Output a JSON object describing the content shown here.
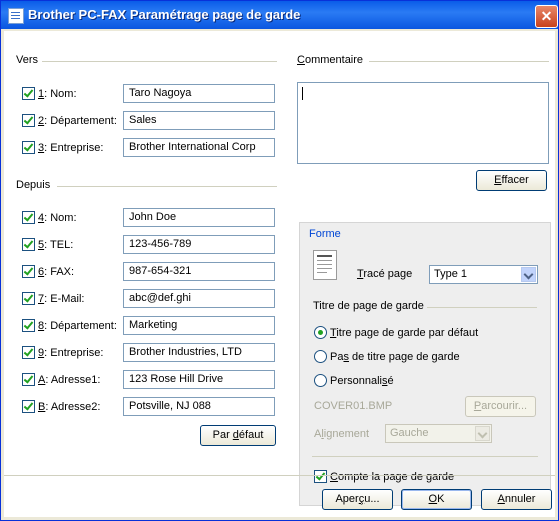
{
  "window": {
    "title": "Brother PC-FAX Paramétrage page de garde",
    "close_glyph": "✕"
  },
  "vers": {
    "label": "Vers",
    "rows": [
      {
        "key": "1",
        "label": ": Nom:",
        "value": "Taro Nagoya",
        "checked": true
      },
      {
        "key": "2",
        "label": ": Département:",
        "value": "Sales",
        "checked": true
      },
      {
        "key": "3",
        "label": ": Entreprise:",
        "value": "Brother International Corp",
        "checked": true
      }
    ]
  },
  "depuis": {
    "label": "Depuis",
    "rows": [
      {
        "key": "4",
        "label": ": Nom:",
        "value": "John Doe",
        "checked": true
      },
      {
        "key": "5",
        "label": ": TEL:",
        "value": "123-456-789",
        "checked": true
      },
      {
        "key": "6",
        "label": ": FAX:",
        "value": "987-654-321",
        "checked": true
      },
      {
        "key": "7",
        "label": ": E-Mail:",
        "value": "abc@def.ghi",
        "checked": true
      },
      {
        "key": "8",
        "label": ": Département:",
        "value": "Marketing",
        "checked": true
      },
      {
        "key": "9",
        "label": ": Entreprise:",
        "value": "Brother Industries, LTD",
        "checked": true
      },
      {
        "key": "A",
        "label": ": Adresse1:",
        "value": "123 Rose Hill Drive",
        "checked": true
      },
      {
        "key": "B",
        "label": ": Adresse2:",
        "value": "Potsville, NJ 088",
        "checked": true
      }
    ],
    "default_button": {
      "pre": "Par ",
      "u": "d",
      "post": "éfaut"
    }
  },
  "commentaire": {
    "label_u": "C",
    "label_rest": "ommentaire",
    "value": "",
    "clear_button": {
      "u": "E",
      "rest": "ffacer"
    }
  },
  "forme": {
    "label": "Forme",
    "trace": {
      "u": "T",
      "rest": "racé page",
      "value": "Type 1"
    },
    "titre_section": "Titre de page de garde",
    "options": [
      {
        "pre": "",
        "u": "T",
        "post": "itre page de garde par défaut",
        "selected": true
      },
      {
        "pre": "Pa",
        "u": "s",
        "post": " de titre page de garde",
        "selected": false
      },
      {
        "pre": "Personnali",
        "u": "s",
        "post": "é",
        "selected": false
      }
    ],
    "file": "COVER01.BMP",
    "browse": {
      "u": "P",
      "rest": "arcourir..."
    },
    "alignement": {
      "pre": "A",
      "u": "l",
      "post": "ignement",
      "value": "Gauche"
    },
    "compte": {
      "u": "C",
      "rest": "ompte la page de garde",
      "checked": true
    }
  },
  "footer": {
    "apercu": {
      "pre": "Aper",
      "u": "ç",
      "post": "u..."
    },
    "ok": {
      "u": "O",
      "rest": "K"
    },
    "annuler": {
      "pre": "",
      "u": "A",
      "post": "nnuler"
    }
  }
}
